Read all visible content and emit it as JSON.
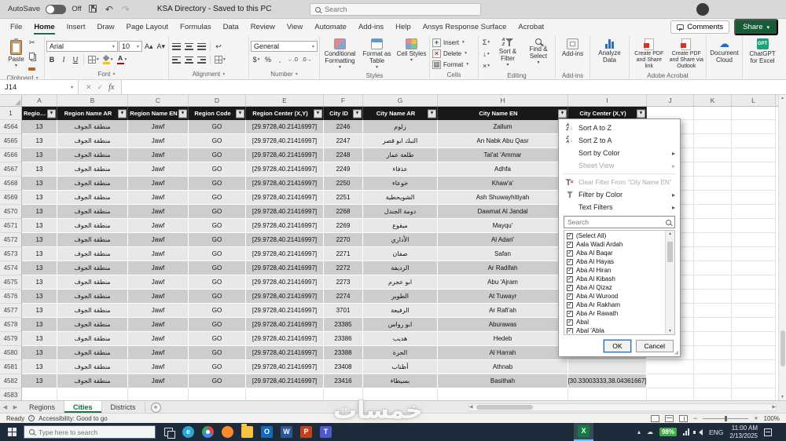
{
  "colors": {
    "excel_green": "#107c41",
    "accent_green": "#1e7145",
    "filter_accent": "#2f6fb5",
    "battery_green": "#3fae49",
    "taskbar_bg": "#1d2b3a",
    "header_black": "#181818"
  },
  "titlebar": {
    "autosave_label": "AutoSave",
    "autosave_state": "Off",
    "title": "KSA Directory - Saved to this PC",
    "search_placeholder": "Search"
  },
  "ribbon_tabs": {
    "items": [
      "File",
      "Home",
      "Insert",
      "Draw",
      "Page Layout",
      "Formulas",
      "Data",
      "Review",
      "View",
      "Automate",
      "Add-ins",
      "Help",
      "Ansys Response Surface",
      "Acrobat"
    ],
    "active": "Home",
    "comments_label": "Comments",
    "share_label": "Share"
  },
  "ribbon": {
    "paste_label": "Paste",
    "clipboard_group": "Clipboard",
    "font_name": "Arial",
    "font_size": "10",
    "font_group": "Font",
    "alignment_group": "Alignment",
    "number_format": "General",
    "number_group": "Number",
    "conditional_formatting": "Conditional Formatting",
    "format_as_table": "Format as Table",
    "cell_styles": "Cell Styles",
    "styles_group": "Styles",
    "insert_label": "Insert",
    "delete_label": "Delete",
    "format_label": "Format",
    "cells_group": "Cells",
    "autosum_label": "Σ",
    "sort_filter_label": "Sort & Filter",
    "find_select_label": "Find & Select",
    "editing_group": "Editing",
    "addins_label": "Add-ins",
    "addins_group": "Add-ins",
    "analyze_data_label": "Analyze Data",
    "create_pdf_link_label": "Create PDF and Share link",
    "create_pdf_outlook_label": "Create PDF and Share via Outlook",
    "acrobat_group": "Adobe Acrobat",
    "document_cloud_label": "Document Cloud",
    "chatgpt_label": "ChatGPT for Excel"
  },
  "formula_bar": {
    "name_box": "J14",
    "fx_label": "fx",
    "cancel_glyph": "✕",
    "enter_glyph": "✓",
    "value": ""
  },
  "grid": {
    "col_letters": [
      "A",
      "B",
      "C",
      "D",
      "E",
      "F",
      "G",
      "H",
      "I",
      "J",
      "K",
      "L"
    ],
    "header_row": [
      "Region ID",
      "Region Name AR",
      "Region Name EN",
      "Region Code",
      "Region Center (X,Y)",
      "City ID",
      "City Name AR",
      "City Name EN",
      "City Center (X,Y)"
    ],
    "filter_open_column": "City Name EN",
    "rows": [
      [
        "4564",
        "13",
        "منطقة الجوف",
        "Jawf",
        "GO",
        "[29.9728,40.21416997]",
        "2246",
        "زلوم",
        "Zallum",
        ""
      ],
      [
        "4565",
        "13",
        "منطقة الجوف",
        "Jawf",
        "GO",
        "[29.9728,40.21416997]",
        "2247",
        "النبك ابو قصر",
        "An Nabk Abu Qasr",
        ""
      ],
      [
        "4566",
        "13",
        "منطقة الجوف",
        "Jawf",
        "GO",
        "[29.9728,40.21416997]",
        "2248",
        "طلعة عمار",
        "Tal'at 'Ammar",
        ""
      ],
      [
        "4567",
        "13",
        "منطقة الجوف",
        "Jawf",
        "GO",
        "[29.9728,40.21416997]",
        "2249",
        "عذفاء",
        "Adhfa",
        ""
      ],
      [
        "4568",
        "13",
        "منطقة الجوف",
        "Jawf",
        "GO",
        "[29.9728,40.21416997]",
        "2250",
        "خوعاء",
        "Khaw'a'",
        ""
      ],
      [
        "4569",
        "13",
        "منطقة الجوف",
        "Jawf",
        "GO",
        "[29.9728,40.21416997]",
        "2251",
        "الشويحطية",
        "Ash Shuwayhitiyah",
        ""
      ],
      [
        "4570",
        "13",
        "منطقة الجوف",
        "Jawf",
        "GO",
        "[29.9728,40.21416997]",
        "2268",
        "دومة الجندل",
        "Dawmat Al Jandal",
        ""
      ],
      [
        "4571",
        "13",
        "منطقة الجوف",
        "Jawf",
        "GO",
        "[29.9728,40.21416997]",
        "2269",
        "ميقوع",
        "Mayqu'",
        ""
      ],
      [
        "4572",
        "13",
        "منطقة الجوف",
        "Jawf",
        "GO",
        "[29.9728,40.21416997]",
        "2270",
        "الأداري",
        "Al Adari'",
        ""
      ],
      [
        "4573",
        "13",
        "منطقة الجوف",
        "Jawf",
        "GO",
        "[29.9728,40.21416997]",
        "2271",
        "صفان",
        "Safan",
        ""
      ],
      [
        "4574",
        "13",
        "منطقة الجوف",
        "Jawf",
        "GO",
        "[29.9728,40.21416997]",
        "2272",
        "الرديفة",
        "Ar Radifah",
        ""
      ],
      [
        "4575",
        "13",
        "منطقة الجوف",
        "Jawf",
        "GO",
        "[29.9728,40.21416997]",
        "2273",
        "ابو عجرم",
        "Abu 'Ajram",
        ""
      ],
      [
        "4576",
        "13",
        "منطقة الجوف",
        "Jawf",
        "GO",
        "[29.9728,40.21416997]",
        "2274",
        "الطوير",
        "At Tuwayr",
        ""
      ],
      [
        "4577",
        "13",
        "منطقة الجوف",
        "Jawf",
        "GO",
        "[29.9728,40.21416997]",
        "3701",
        "الرفيعة",
        "Ar Rafi'ah",
        ""
      ],
      [
        "4578",
        "13",
        "منطقة الجوف",
        "Jawf",
        "GO",
        "[29.9728,40.21416997]",
        "23385",
        "ابو رواس",
        "Aburawas",
        ""
      ],
      [
        "4579",
        "13",
        "منطقة الجوف",
        "Jawf",
        "GO",
        "[29.9728,40.21416997]",
        "23386",
        "هديب",
        "Hedeb",
        ""
      ],
      [
        "4580",
        "13",
        "منطقة الجوف",
        "Jawf",
        "GO",
        "[29.9728,40.21416997]",
        "23388",
        "الحرة",
        "Al Harrah",
        ""
      ],
      [
        "4581",
        "13",
        "منطقة الجوف",
        "Jawf",
        "GO",
        "[29.9728,40.21416997]",
        "23408",
        "أظناب",
        "Athnab",
        ""
      ],
      [
        "4582",
        "13",
        "منطقة الجوف",
        "Jawf",
        "GO",
        "[29.9728,40.21416997]",
        "23416",
        "بسيطاء",
        "Basithah",
        "[30.33003333,38.04361667]"
      ],
      [
        "4583",
        "",
        "",
        "",
        "",
        "",
        "",
        "",
        "",
        ""
      ]
    ]
  },
  "filter_menu": {
    "sort_az": "Sort A to Z",
    "sort_za": "Sort Z to A",
    "sort_by_color": "Sort by Color",
    "sheet_view": "Sheet View",
    "clear_filter": "Clear Filter From \"City Name EN\"",
    "filter_by_color": "Filter by Color",
    "text_filters": "Text Filters",
    "search_placeholder": "Search",
    "values": [
      "(Select All)",
      "Aala Wadi Ardah",
      "Aba Al Baqar",
      "Aba Al Hayas",
      "Aba Al Hiran",
      "Aba Al Kibash",
      "Aba Al Qizaz",
      "Aba Al Wurood",
      "Aba Ar Rakham",
      "Aba Ar Rawath",
      "Abal",
      "Abal 'Abla"
    ],
    "ok_label": "OK",
    "cancel_label": "Cancel"
  },
  "sheet_tabs": {
    "tabs": [
      "Regions",
      "Cities",
      "Districts"
    ],
    "active": "Cities",
    "add_label": "+"
  },
  "status_bar": {
    "ready_label": "Ready",
    "accessibility_label": "Accessibility: Good to go",
    "zoom_label": "100%"
  },
  "watermark_text": "خمسات",
  "taskbar": {
    "search_placeholder": "Type here to search",
    "apps": [
      {
        "name": "task-view-icon",
        "kind": "taskview",
        "letter": ""
      },
      {
        "name": "edge-browser-icon",
        "kind": "circle",
        "color": "#2aa7d8",
        "letter": "e"
      },
      {
        "name": "chrome-icon",
        "kind": "chrome",
        "letter": ""
      },
      {
        "name": "firefox-icon",
        "kind": "circle",
        "color": "#ff8a2a",
        "letter": ""
      },
      {
        "name": "file-explorer-icon",
        "kind": "folder",
        "color": "#f5c344",
        "letter": ""
      },
      {
        "name": "outlook-icon",
        "kind": "tile",
        "color": "#1269bf",
        "letter": "O"
      },
      {
        "name": "word-icon",
        "kind": "tile",
        "color": "#2b579a",
        "letter": "W"
      },
      {
        "name": "powerpoint-icon",
        "kind": "tile",
        "color": "#c4401c",
        "letter": "P"
      },
      {
        "name": "teams-icon",
        "kind": "tile",
        "color": "#5059c9",
        "letter": "T"
      }
    ],
    "excel_app": {
      "name": "excel-taskbar-icon",
      "kind": "tile",
      "color": "#107c41",
      "letter": "X"
    },
    "tray": {
      "battery_label": "98%",
      "lang_label": "ENG",
      "time_label": "11:00 AM",
      "date_label": "2/13/2025"
    }
  }
}
